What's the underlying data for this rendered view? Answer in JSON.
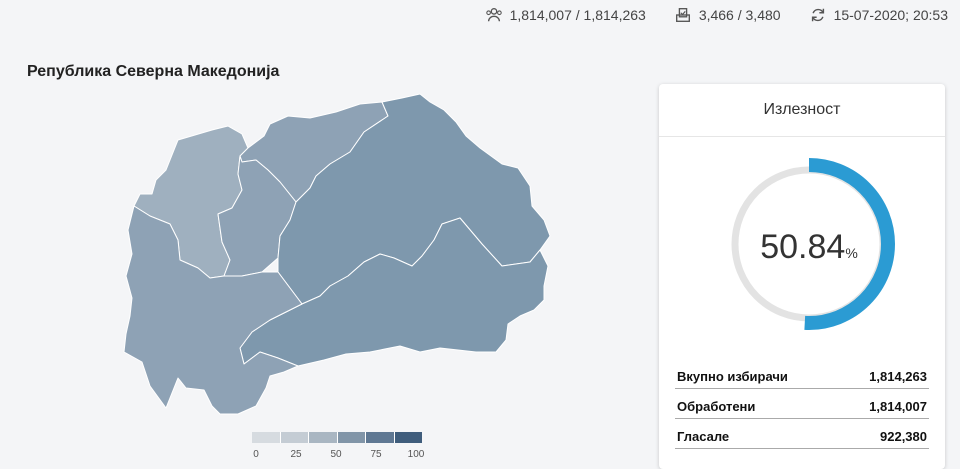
{
  "header": {
    "voters": "1,814,007 / 1,814,263",
    "stations": "3,466 / 3,480",
    "updated": "15-07-2020; 20:53"
  },
  "map": {
    "title": "Република Северна Македонија",
    "legend_ticks": [
      "0",
      "25",
      "50",
      "75",
      "100"
    ],
    "legend_colors": [
      "#d6dbe0",
      "#c4ccd4",
      "#a9b6c2",
      "#8195a8",
      "#5f7893",
      "#3f5d7c"
    ],
    "region_colors": {
      "light": "#9fb0bf",
      "medium": "#8ea2b5",
      "dark": "#7e98ad"
    }
  },
  "turnout_card": {
    "title": "Излезност",
    "value": "50.84",
    "unit": "%",
    "fraction": 0.5084,
    "accent": "#2b9bd3",
    "rows": [
      {
        "label": "Вкупно избирачи",
        "value": "1,814,263"
      },
      {
        "label": "Обработени",
        "value": "1,814,007"
      },
      {
        "label": "Гласале",
        "value": "922,380"
      }
    ]
  }
}
